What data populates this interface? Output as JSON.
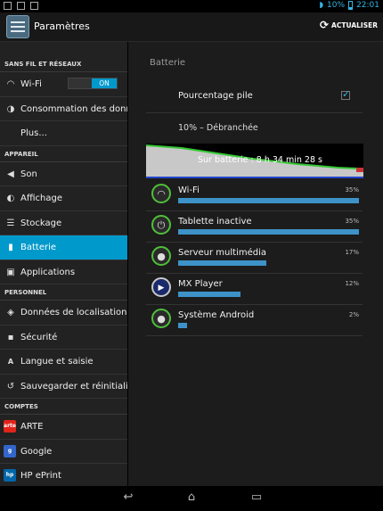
{
  "status_bar": {
    "battery_text": "10%",
    "time": "22:01"
  },
  "action_bar": {
    "title": "Paramètres",
    "refresh_label": "ACTUALISER"
  },
  "sidebar": {
    "sections": [
      {
        "header": "SANS FIL ET RÉSEAUX",
        "items": [
          {
            "label": "Wi-Fi",
            "icon": "wifi-icon",
            "toggle": "ON"
          },
          {
            "label": "Consommation des données",
            "icon": "data-usage-icon"
          },
          {
            "label": "Plus...",
            "icon": ""
          }
        ]
      },
      {
        "header": "APPAREIL",
        "items": [
          {
            "label": "Son",
            "icon": "sound-icon"
          },
          {
            "label": "Affichage",
            "icon": "display-icon"
          },
          {
            "label": "Stockage",
            "icon": "storage-icon"
          },
          {
            "label": "Batterie",
            "icon": "battery-icon",
            "active": true
          },
          {
            "label": "Applications",
            "icon": "applications-icon"
          }
        ]
      },
      {
        "header": "PERSONNEL",
        "items": [
          {
            "label": "Données de localisation",
            "icon": "location-icon"
          },
          {
            "label": "Sécurité",
            "icon": "lock-icon"
          },
          {
            "label": "Langue et saisie",
            "icon": "language-icon"
          },
          {
            "label": "Sauvegarder et réinitialiser",
            "icon": "backup-icon"
          }
        ]
      },
      {
        "header": "COMPTES",
        "items": [
          {
            "label": "ARTE",
            "icon": "arte-icon",
            "badge": "arte",
            "badge_color": "#e2231a"
          },
          {
            "label": "Google",
            "icon": "google-icon",
            "badge": "g",
            "badge_color": "#3366cc"
          },
          {
            "label": "HP ePrint",
            "icon": "hp-eprint-icon",
            "badge": "hp",
            "badge_color": "#0066aa"
          }
        ]
      }
    ]
  },
  "battery": {
    "breadcrumb": "Batterie",
    "percentage_label": "Pourcentage pile",
    "percentage_checked": true,
    "status": "10% – Débranchée",
    "graph_text": "Sur batterie : 8 h 34 min 28 s",
    "usage": [
      {
        "name": "Wi-Fi",
        "percent": 35,
        "percent_label": "35%",
        "icon": "wifi-icon"
      },
      {
        "name": "Tablette inactive",
        "percent": 35,
        "percent_label": "35%",
        "icon": "power-icon"
      },
      {
        "name": "Serveur multimédia",
        "percent": 17,
        "percent_label": "17%",
        "icon": "android-icon"
      },
      {
        "name": "MX Player",
        "percent": 12,
        "percent_label": "12%",
        "icon": "mx-player-icon"
      },
      {
        "name": "Système Android",
        "percent": 2,
        "percent_label": "2%",
        "icon": "android-icon"
      }
    ]
  },
  "colors": {
    "accent": "#0099cc",
    "bar": "#3d93c8",
    "graph_fill": "#c8c8c8",
    "graph_line": "#35c835"
  }
}
